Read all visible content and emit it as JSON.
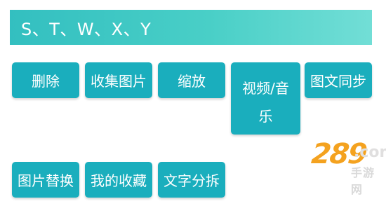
{
  "header": {
    "title": "S、T、W、X、Y",
    "gradient_start": "#33bfc0",
    "gradient_end": "#72ded6"
  },
  "buttons": {
    "accent": "#1aaebd",
    "row1": [
      "删除",
      "收集图片",
      "缩放",
      "视频/音",
      "乐",
      "图文同步"
    ],
    "row2": [
      "图片替换",
      "我的收藏",
      "文字分拆"
    ]
  },
  "watermark": {
    "brand": "289",
    "suffix": ".com",
    "subtitle": "手游网"
  }
}
